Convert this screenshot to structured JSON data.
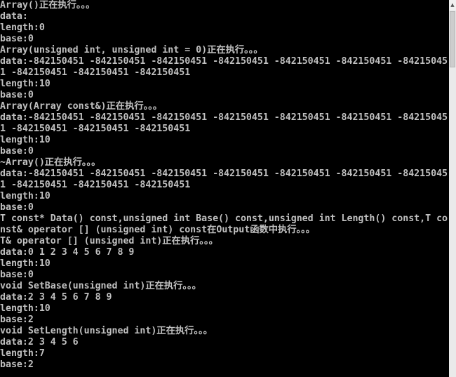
{
  "console": {
    "lines": [
      "Array()正在执行。。。",
      "data:",
      "length:0",
      "base:0",
      "Array(unsigned int, unsigned int = 0)正在执行。。。",
      "data:-842150451 -842150451 -842150451 -842150451 -842150451 -842150451 -84215045",
      "1 -842150451 -842150451 -842150451",
      "length:10",
      "base:0",
      "Array(Array const&)正在执行。。。",
      "data:-842150451 -842150451 -842150451 -842150451 -842150451 -842150451 -84215045",
      "1 -842150451 -842150451 -842150451",
      "length:10",
      "base:0",
      "~Array()正在执行。。。",
      "data:-842150451 -842150451 -842150451 -842150451 -842150451 -842150451 -84215045",
      "1 -842150451 -842150451 -842150451",
      "length:10",
      "base:0",
      "T const* Data() const,unsigned int Base() const,unsigned int Length() const,T co",
      "nst& operator [] (unsigned int) const在Output函数中执行。。。",
      "T& operator [] (unsigned int)正在执行。。。",
      "data:0 1 2 3 4 5 6 7 8 9",
      "length:10",
      "base:0",
      "void SetBase(unsigned int)正在执行。。。",
      "data:2 3 4 5 6 7 8 9",
      "length:10",
      "base:2",
      "void SetLength(unsigned int)正在执行。。。",
      "data:2 3 4 5 6",
      "length:7",
      "base:2"
    ]
  },
  "scrollbar": {
    "up_arrow_icon": "▲"
  },
  "colors": {
    "background": "#000000",
    "text": "#c0c0c0"
  }
}
